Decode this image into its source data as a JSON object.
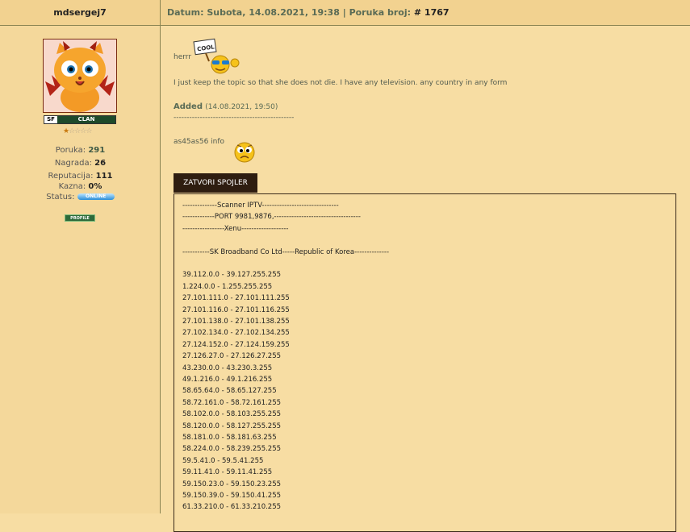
{
  "header": {
    "username": "mdsergej7",
    "date_label": "Datum:",
    "date_value": "Subota, 14.08.2021, 19:38",
    "separator": "|",
    "post_label": "Poruka broj:",
    "post_number": "# 1767"
  },
  "sidebar": {
    "clan_prefix": "SF",
    "clan_label": "CLAN",
    "stars_total": 5,
    "stars_on": 1,
    "stats": {
      "poruka_label": "Poruka:",
      "poruka_value": "291",
      "nagrada_label": "Nagrada:",
      "nagrada_value": "26",
      "reputacija_label": "Reputacija:",
      "reputacija_value": "111",
      "kazna_label": "Kazna:",
      "kazna_value": "0%",
      "status_label": "Status:",
      "status_value": "ONLINE"
    },
    "profile_button": "PROFILE"
  },
  "post": {
    "line1": "herrr",
    "cool_sign": "COOL",
    "line2": "I just keep the topic so that she does not die. I have any television. any country in any form",
    "added_label": "Added",
    "added_time": "(14.08.2021, 19:50)",
    "dashes": "----------------------------------------------",
    "info_text": "as45as56 info",
    "spoiler_button": "ZATVORI SPOJLER",
    "spoiler_lines": [
      "--------------Scanner IPTV-------------------------------",
      "-------------PORT 9981,9876,-----------------------------------",
      "-----------------Xenu-------------------",
      "",
      "-----------SK Broadband Co Ltd-----Republic of Korea--------------",
      "",
      "39.112.0.0 - 39.127.255.255",
      "1.224.0.0 - 1.255.255.255",
      "27.101.111.0 - 27.101.111.255",
      "27.101.116.0 - 27.101.116.255",
      "27.101.138.0 - 27.101.138.255",
      "27.102.134.0 - 27.102.134.255",
      "27.124.152.0 - 27.124.159.255",
      "27.126.27.0 - 27.126.27.255",
      "43.230.0.0 - 43.230.3.255",
      "49.1.216.0 - 49.1.216.255",
      "58.65.64.0 - 58.65.127.255",
      "58.72.161.0 - 58.72.161.255",
      "58.102.0.0 - 58.103.255.255",
      "58.120.0.0 - 58.127.255.255",
      "58.181.0.0 - 58.181.63.255",
      "58.224.0.0 - 58.239.255.255",
      "59.5.41.0 - 59.5.41.255",
      "59.11.41.0 - 59.11.41.255",
      "59.150.23.0 - 59.150.23.255",
      "59.150.39.0 - 59.150.41.255",
      "61.33.210.0 - 61.33.210.255"
    ]
  },
  "colors": {
    "header_bg": "#f2d290",
    "sidebar_bg": "#f4d89b",
    "content_bg": "#f7dda3",
    "spoiler_button_bg": "#2e1d10",
    "accent_text": "#5a6b55"
  }
}
